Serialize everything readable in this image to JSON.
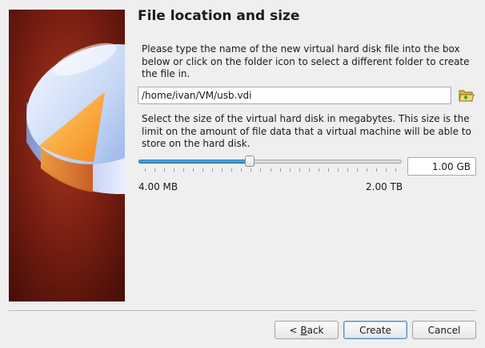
{
  "page": {
    "title": "File location and size"
  },
  "location": {
    "description": "Please type the name of the new virtual hard disk file into the box below or click on the folder icon to select a different folder to create the file in.",
    "path_value": "/home/ivan/VM/usb.vdi",
    "folder_icon": "folder-open-icon"
  },
  "size": {
    "description": "Select the size of the virtual hard disk in megabytes. This size is the limit on the amount of file data that a virtual machine will be able to store on the hard disk.",
    "slider_fraction": 0.42,
    "tick_count": 27,
    "min_label": "4.00 MB",
    "max_label": "2.00 TB",
    "value": "1.00 GB"
  },
  "buttons": {
    "back_mnemonic": "B",
    "back_rest": "ack",
    "back_prefix": "< ",
    "create_label": "Create",
    "cancel_label": "Cancel"
  },
  "colors": {
    "accent": "#3a8fd0",
    "banner_bg": "#6a1a10"
  }
}
